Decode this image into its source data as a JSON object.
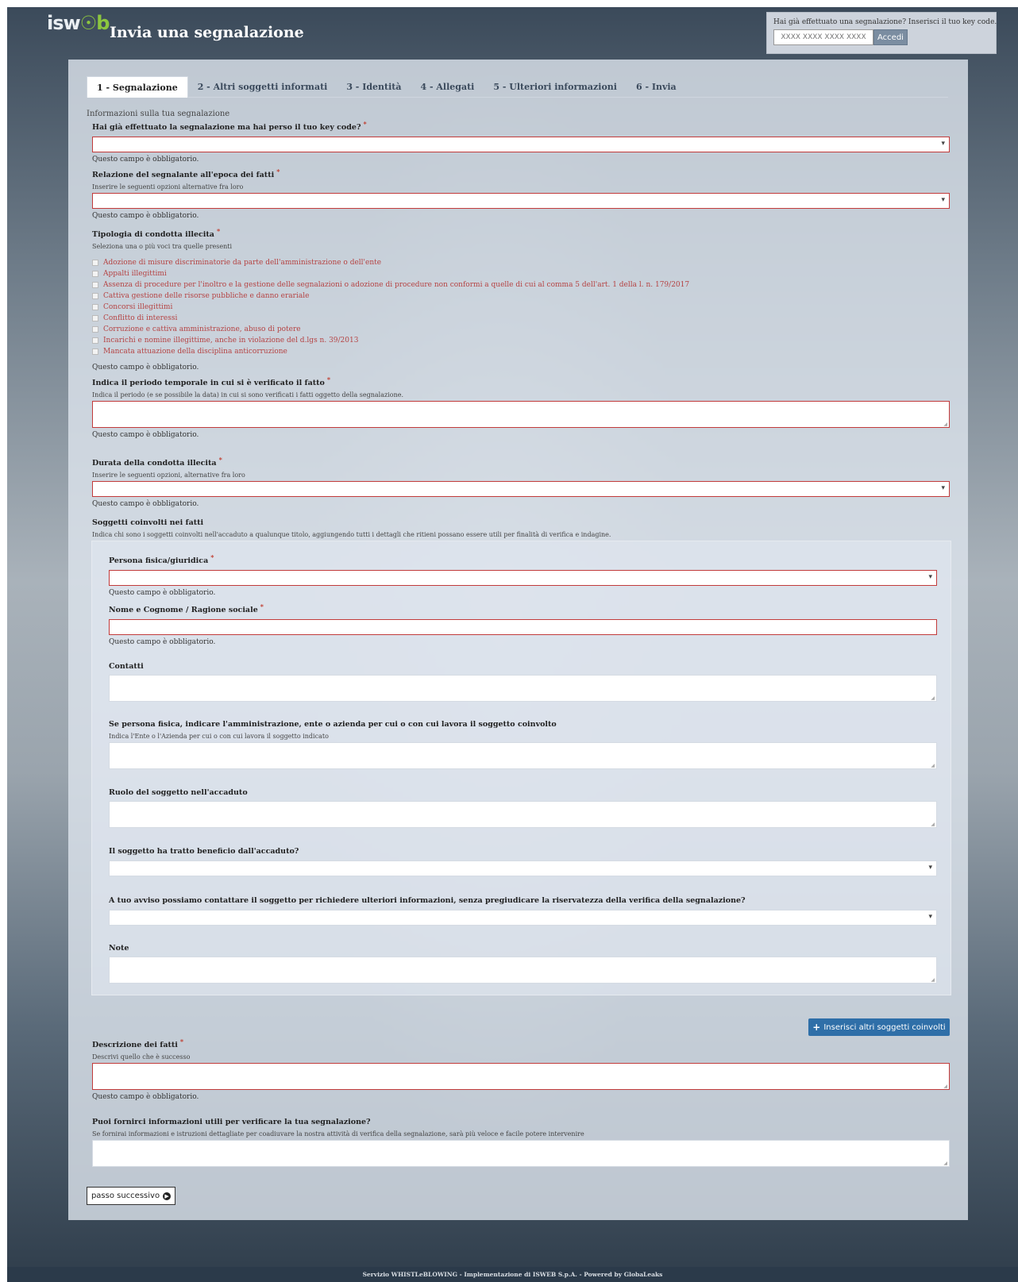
{
  "header": {
    "logo_main": "isw",
    "logo_accent": "☉b",
    "title": "Invia una segnalazione",
    "key_question": "Hai già effettuato una segnalazione? Inserisci il tuo key code.",
    "key_placeholder": "XXXX XXXX XXXX XXXX",
    "login_label": "Accedi"
  },
  "tabs": [
    {
      "label": "1 - Segnalazione"
    },
    {
      "label": "2 - Altri soggetti informati"
    },
    {
      "label": "3 - Identità"
    },
    {
      "label": "4 - Allegati"
    },
    {
      "label": "5 - Ulteriori informazioni"
    },
    {
      "label": "6 - Invia"
    }
  ],
  "form": {
    "intro": "Informazioni sulla tua segnalazione",
    "required_mark": "*",
    "error_text": "Questo campo è obbligatorio.",
    "lost_key": {
      "label": "Hai già effettuato la segnalazione ma hai perso il tuo key code?"
    },
    "relation": {
      "label": "Relazione del segnalante all'epoca dei fatti",
      "hint": "Inserire le seguenti opzioni alternative fra loro"
    },
    "conduct": {
      "label": "Tipologia di condotta illecita",
      "hint": "Seleziona una o più voci tra quelle presenti",
      "options": [
        "Adozione di misure discriminatorie da parte dell'amministrazione o dell'ente",
        "Appalti illegittimi",
        "Assenza di procedure per l'inoltro e la gestione delle segnalazioni o adozione di procedure non conformi a quelle di cui al comma 5 dell'art. 1 della l. n. 179/2017",
        "Cattiva gestione delle risorse pubbliche e danno erariale",
        "Concorsi illegittimi",
        "Conflitto di interessi",
        "Corruzione e cattiva amministrazione, abuso di potere",
        "Incarichi e nomine illegittime, anche in violazione del d.lgs n. 39/2013",
        "Mancata attuazione della disciplina anticorruzione"
      ]
    },
    "period": {
      "label": "Indica il periodo temporale in cui si è verificato il fatto",
      "hint": "Indica il periodo (e se possibile la data) in cui si sono verificati i fatti oggetto della segnalazione."
    },
    "duration": {
      "label": "Durata della condotta illecita",
      "hint": "Inserire le seguenti opzioni, alternative fra loro"
    },
    "subjects": {
      "label": "Soggetti coinvolti nei fatti",
      "hint": "Indica chi sono i soggetti coinvolti nell'accaduto a qualunque titolo, aggiungendo tutti i dettagli che ritieni possano essere utili per finalità di verifica e indagine.",
      "person_type": "Persona fisica/giuridica",
      "name": "Nome e Cognome / Ragione sociale",
      "contacts": "Contatti",
      "employer": "Se persona fisica, indicare l'amministrazione, ente o azienda per cui o con cui lavora il soggetto coinvolto",
      "employer_hint": "Indica l'Ente o l'Azienda per cui o con cui lavora il soggetto indicato",
      "role": "Ruolo del soggetto nell'accaduto",
      "benefit": "Il soggetto ha tratto beneficio dall'accaduto?",
      "contact_ok": "A tuo avviso possiamo contattare il soggetto per richiedere ulteriori informazioni, senza pregiudicare la riservatezza della verifica della segnalazione?",
      "notes": "Note"
    },
    "add_subjects_label": "Inserisci altri soggetti coinvolti",
    "description": {
      "label": "Descrizione dei fatti",
      "hint": "Descrivi quello che è successo"
    },
    "verify": {
      "label": "Puoi fornirci informazioni utili per verificare la tua segnalazione?",
      "hint": "Se fornirai informazioni e istruzioni dettagliate per coadiuvare la nostra attività di verifica della segnalazione, sarà più veloce e facile potere intervenire"
    },
    "next_label": "passo successivo"
  },
  "footer": {
    "text": "Servizio WHISTLeBLOWING - Implementazione di ISWEB S.p.A. - Powered by GlobaLeaks"
  }
}
